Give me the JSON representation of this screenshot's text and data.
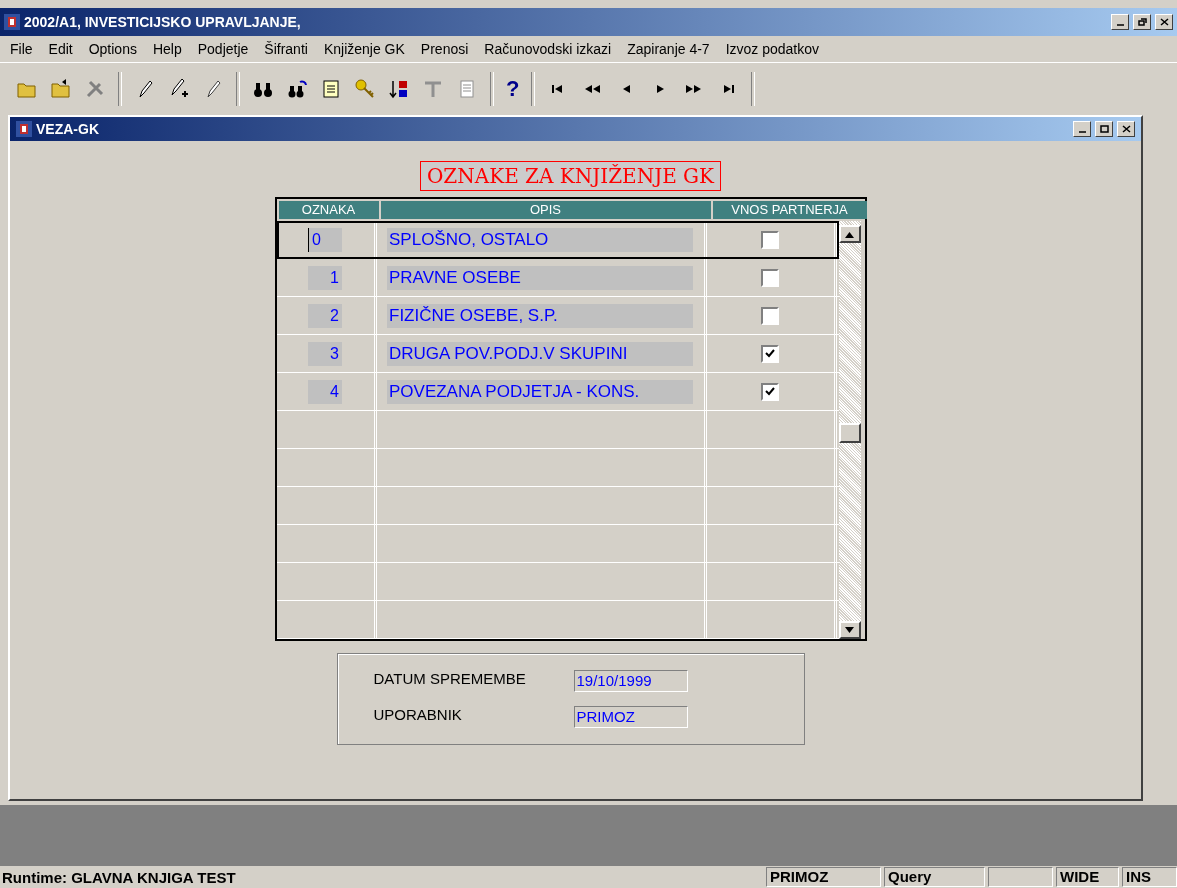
{
  "window": {
    "title": "2002/A1, INVESTICIJSKO UPRAVLJANJE,"
  },
  "menu": [
    "File",
    "Edit",
    "Options",
    "Help",
    "Podjetje",
    "Šifranti",
    "Knjiženje GK",
    "Prenosi",
    "Računovodski izkazi",
    "Zapiranje 4-7",
    "Izvoz podatkov"
  ],
  "toolbar": {
    "help_label": "?"
  },
  "child_window": {
    "title": "VEZA-GK"
  },
  "form_title": "OZNAKE ZA KNJIŽENJE GK",
  "table": {
    "columns": [
      "OZNAKA",
      "OPIS",
      "VNOS PARTNERJA"
    ],
    "rows": [
      {
        "oznaka": "0",
        "opis": "SPLOŠNO, OSTALO",
        "vnos_partnerja": false,
        "selected": true
      },
      {
        "oznaka": "1",
        "opis": "PRAVNE OSEBE",
        "vnos_partnerja": false,
        "selected": false
      },
      {
        "oznaka": "2",
        "opis": "FIZIČNE OSEBE, S.P.",
        "vnos_partnerja": false,
        "selected": false
      },
      {
        "oznaka": "3",
        "opis": "DRUGA POV.PODJ.V SKUPINI",
        "vnos_partnerja": true,
        "selected": false
      },
      {
        "oznaka": "4",
        "opis": "POVEZANA PODJETJA - KONS.",
        "vnos_partnerja": true,
        "selected": false
      }
    ]
  },
  "details": [
    {
      "label": "DATUM SPREMEMBE",
      "value": "19/10/1999"
    },
    {
      "label": "UPORABNIK",
      "value": "PRIMOZ"
    }
  ],
  "status_bar": {
    "text": "Runtime: GLAVNA KNJIGA TEST",
    "panels": [
      "PRIMOZ",
      "Query",
      "WIDE",
      "INS"
    ]
  }
}
